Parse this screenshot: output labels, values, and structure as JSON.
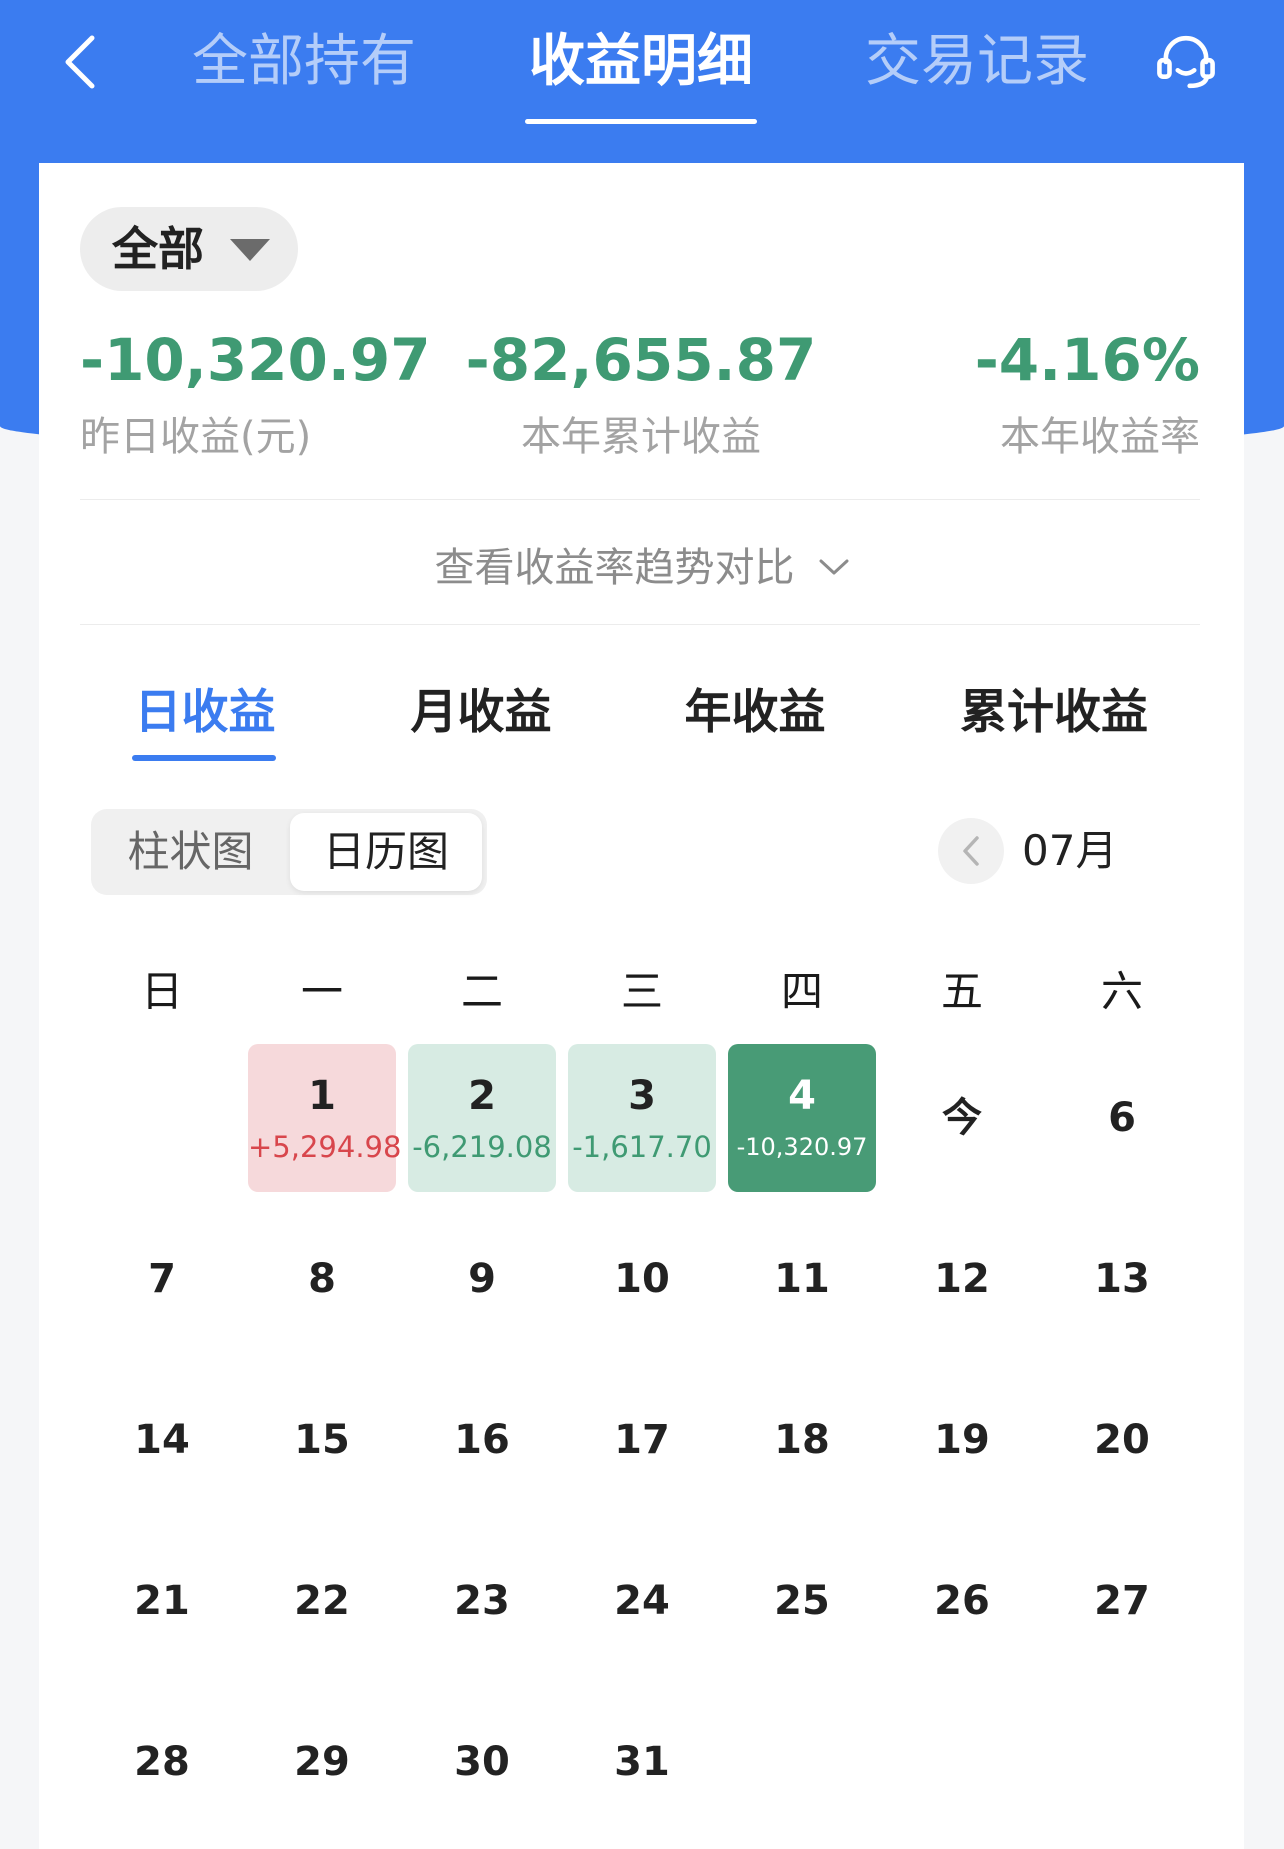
{
  "header": {
    "back_icon": "chevron-left-icon",
    "tabs": [
      {
        "label": "全部持有",
        "active": false
      },
      {
        "label": "收益明细",
        "active": true
      },
      {
        "label": "交易记录",
        "active": false
      }
    ],
    "service_icon": "headset-icon"
  },
  "filter": {
    "label": "全部",
    "icon": "caret-down-icon"
  },
  "summary": {
    "yesterday": {
      "value": "-10,320.97",
      "label": "昨日收益(元)"
    },
    "ytd_total": {
      "value": "-82,655.87",
      "label": "本年累计收益"
    },
    "ytd_rate": {
      "value": "-4.16%",
      "label": "本年收益率"
    }
  },
  "trend": {
    "label": "查看收益率趋势对比",
    "icon": "chevron-down-icon"
  },
  "period_tabs": [
    {
      "label": "日收益",
      "active": true
    },
    {
      "label": "月收益",
      "active": false
    },
    {
      "label": "年收益",
      "active": false
    },
    {
      "label": "累计收益",
      "active": false
    }
  ],
  "view_toggle": {
    "options": [
      {
        "label": "柱状图",
        "selected": false
      },
      {
        "label": "日历图",
        "selected": true
      }
    ]
  },
  "month_nav": {
    "prev_icon": "chevron-left-icon",
    "label": "07月"
  },
  "calendar": {
    "weekdays": [
      "日",
      "一",
      "二",
      "三",
      "四",
      "五",
      "六"
    ],
    "weeks": [
      [
        null,
        {
          "day": "1",
          "amount": "+5,294.98",
          "status": "gain"
        },
        {
          "day": "2",
          "amount": "-6,219.08",
          "status": "loss"
        },
        {
          "day": "3",
          "amount": "-1,617.70",
          "status": "loss"
        },
        {
          "day": "4",
          "amount": "-10,320.97",
          "status": "loss",
          "selected": true
        },
        {
          "day": "今",
          "is_today": true
        },
        {
          "day": "6"
        }
      ],
      [
        {
          "day": "7"
        },
        {
          "day": "8"
        },
        {
          "day": "9"
        },
        {
          "day": "10"
        },
        {
          "day": "11"
        },
        {
          "day": "12"
        },
        {
          "day": "13"
        }
      ],
      [
        {
          "day": "14"
        },
        {
          "day": "15"
        },
        {
          "day": "16"
        },
        {
          "day": "17"
        },
        {
          "day": "18"
        },
        {
          "day": "19"
        },
        {
          "day": "20"
        }
      ],
      [
        {
          "day": "21"
        },
        {
          "day": "22"
        },
        {
          "day": "23"
        },
        {
          "day": "24"
        },
        {
          "day": "25"
        },
        {
          "day": "26"
        },
        {
          "day": "27"
        }
      ],
      [
        {
          "day": "28"
        },
        {
          "day": "29"
        },
        {
          "day": "30"
        },
        {
          "day": "31"
        },
        null,
        null,
        null
      ]
    ]
  },
  "colors": {
    "accent": "#3b7cf0",
    "gain": "#d8464c",
    "gain_bg": "#f6d9db",
    "loss": "#3f9a73",
    "loss_bg": "#d7ebe3",
    "selected_bg": "#489b76"
  }
}
